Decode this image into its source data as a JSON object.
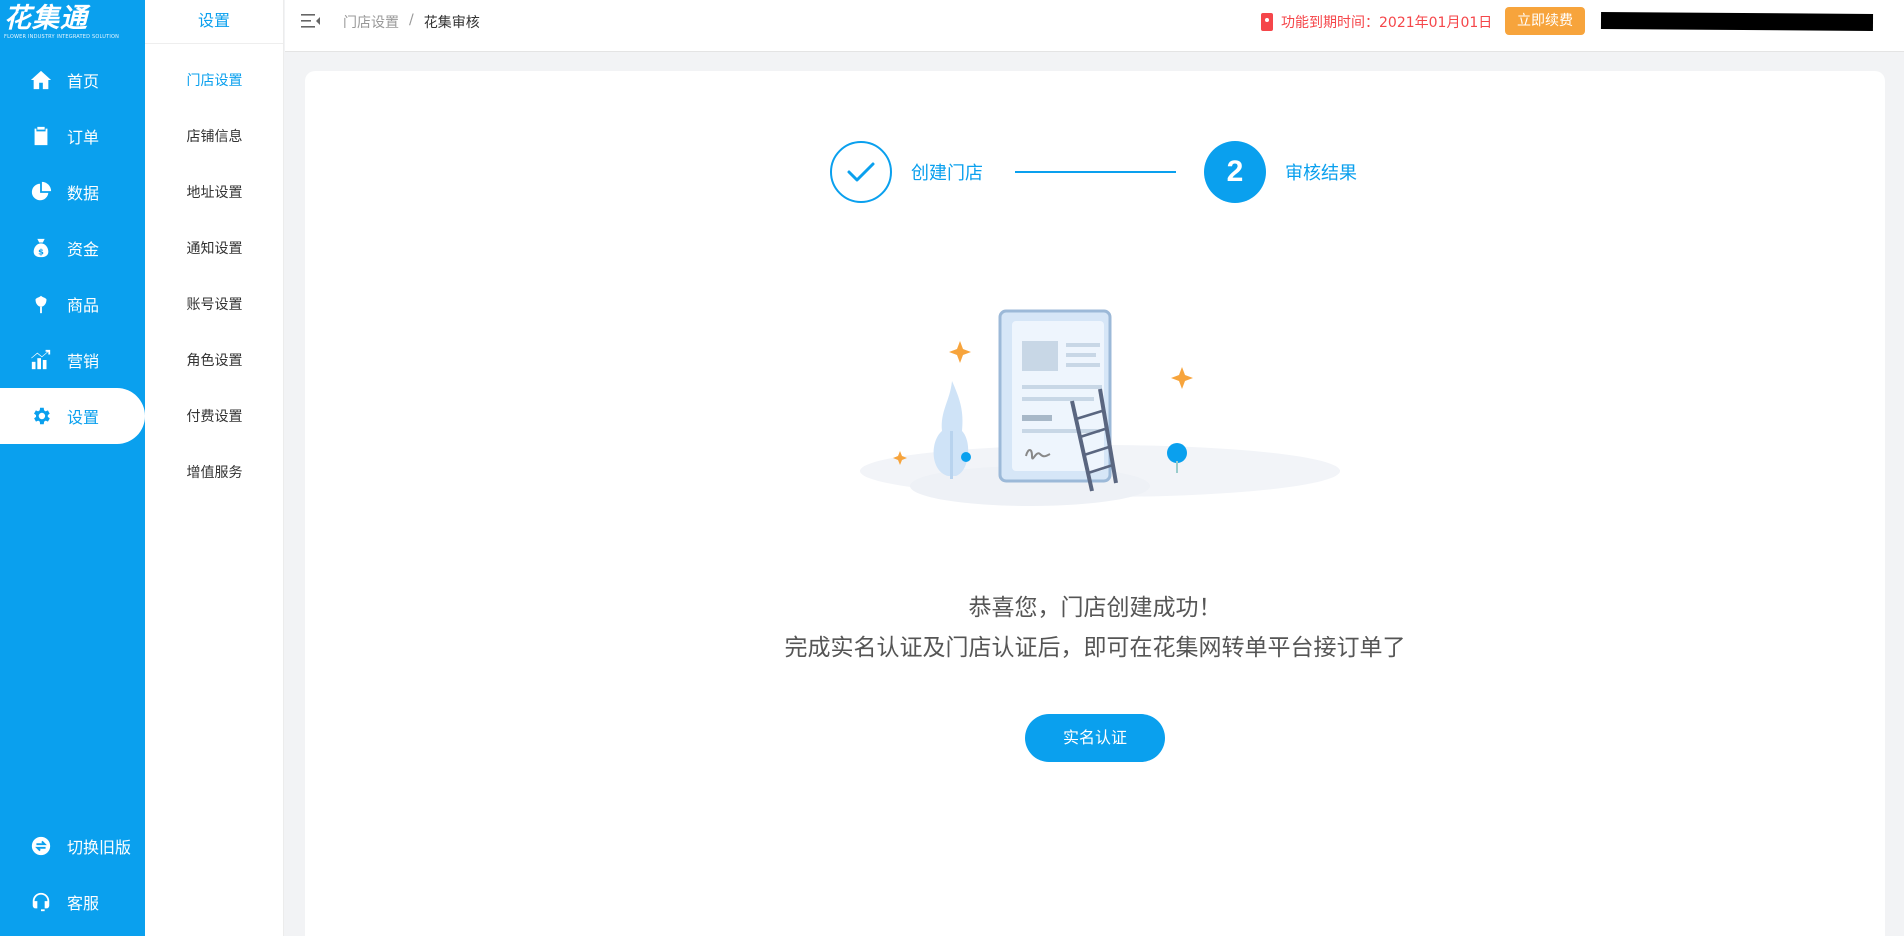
{
  "brand": {
    "logo_text": "花集通",
    "logo_subtitle": "FLOWER INDUSTRY INTEGRATED SOLUTION",
    "accent": "#0aa0ee"
  },
  "nav": {
    "items": [
      {
        "label": "首页",
        "icon": "home-icon"
      },
      {
        "label": "订单",
        "icon": "clipboard-icon"
      },
      {
        "label": "数据",
        "icon": "pie-chart-icon"
      },
      {
        "label": "资金",
        "icon": "money-bag-icon"
      },
      {
        "label": "商品",
        "icon": "flower-icon"
      },
      {
        "label": "营销",
        "icon": "chart-growth-icon"
      },
      {
        "label": "设置",
        "icon": "gear-icon",
        "active": true
      }
    ],
    "bottom": [
      {
        "label": "切换旧版",
        "icon": "switch-icon"
      },
      {
        "label": "客服",
        "icon": "headset-icon"
      }
    ]
  },
  "submenu": {
    "title": "设置",
    "items": [
      "门店设置",
      "店铺信息",
      "地址设置",
      "通知设置",
      "账号设置",
      "角色设置",
      "付费设置",
      "增值服务"
    ],
    "active_index": 0
  },
  "header": {
    "breadcrumb": [
      "门店设置",
      "花集审核"
    ],
    "breadcrumb_separator": "/",
    "expire_text": "功能到期时间：2021年01月01日",
    "renew_label": "立即续费",
    "expire_color": "#f5464a",
    "renew_color": "#f7a43c"
  },
  "steps": {
    "step1_label": "创建门店",
    "step2_number": "2",
    "step2_label": "审核结果"
  },
  "result": {
    "line1": "恭喜您，门店创建成功！",
    "line2": "完成实名认证及门店认证后，即可在花集网转单平台接订单了",
    "button_label": "实名认证"
  }
}
